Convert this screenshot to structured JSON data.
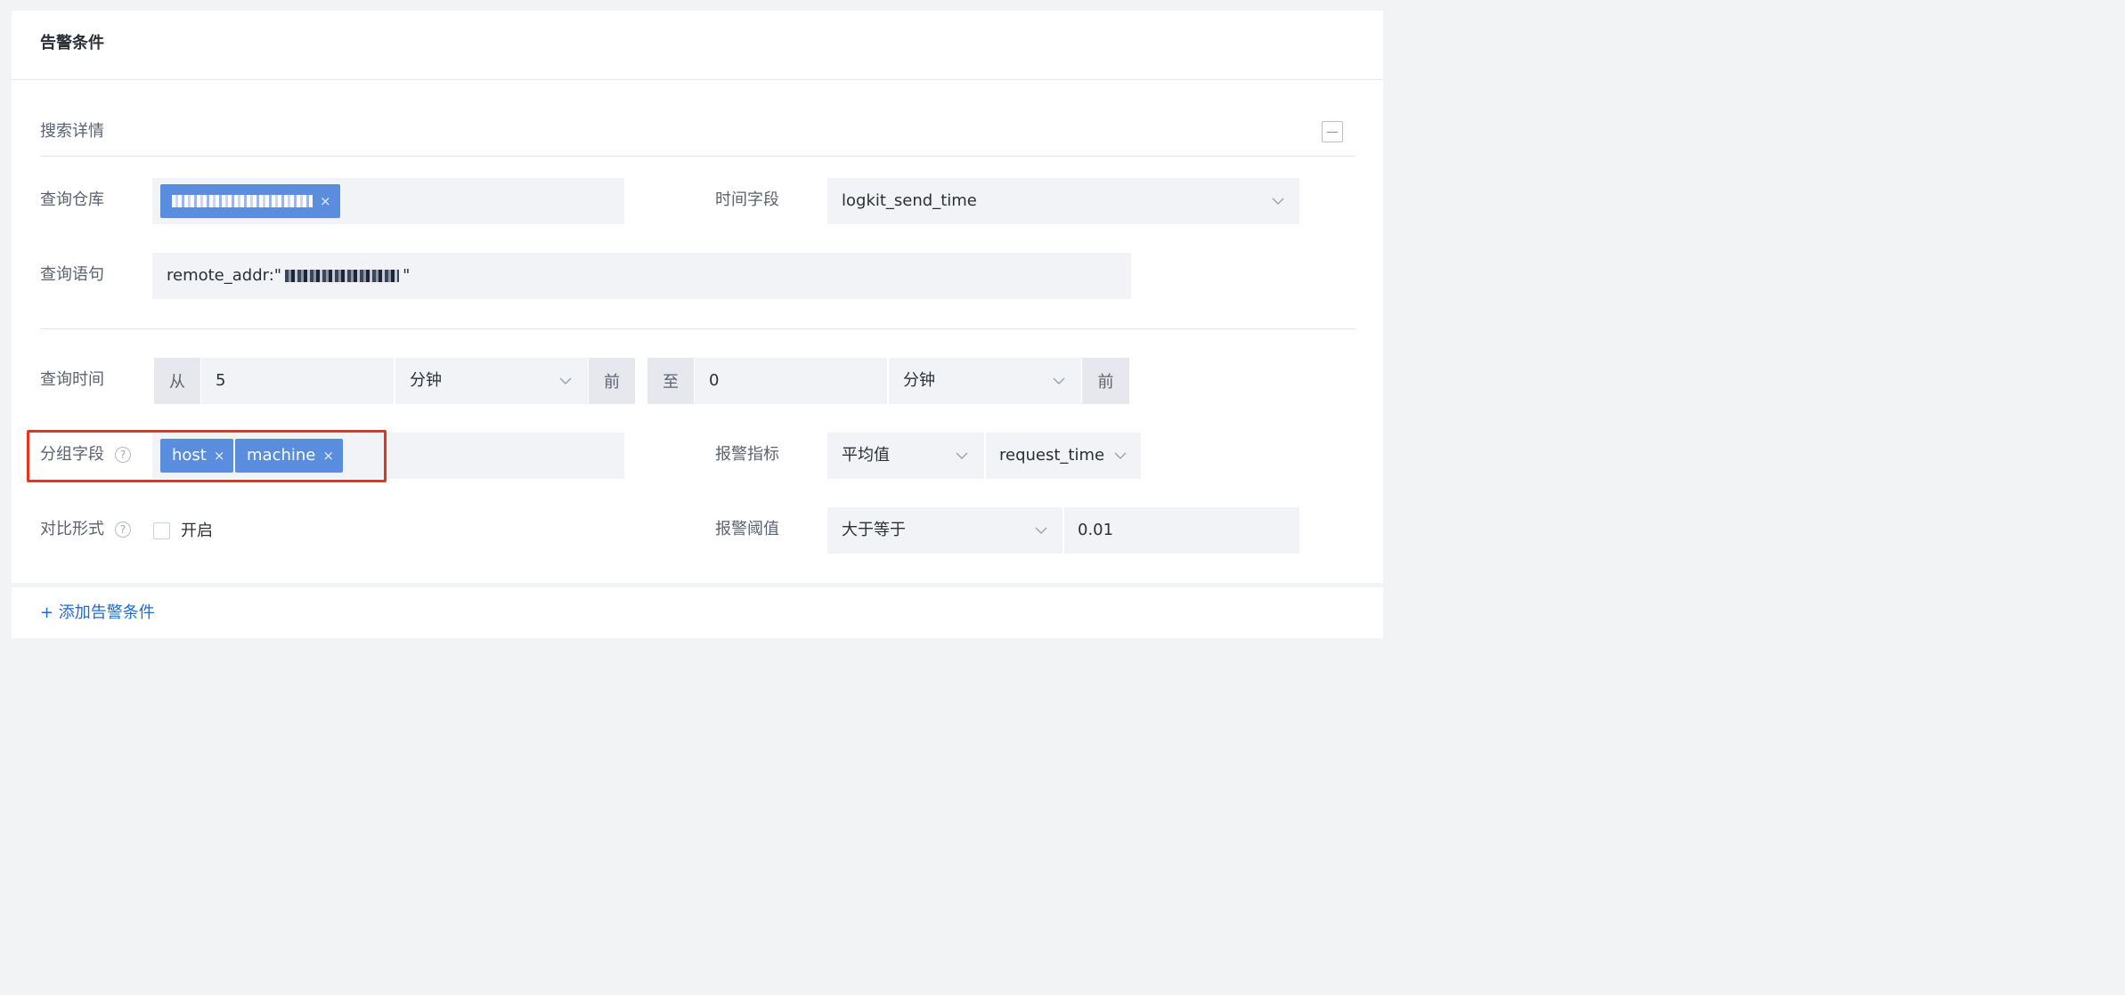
{
  "section": {
    "title": "告警条件"
  },
  "search_detail": {
    "title": "搜索详情"
  },
  "fields": {
    "repo": {
      "label": "查询仓库",
      "tag_close": "×"
    },
    "time_field": {
      "label": "时间字段",
      "value": "logkit_send_time"
    },
    "query": {
      "label": "查询语句",
      "prefix": "remote_addr:\"",
      "suffix": "\""
    },
    "query_time": {
      "label": "查询时间",
      "from_label": "从",
      "from_value": "5",
      "from_unit": "分钟",
      "from_suffix": "前",
      "to_label": "至",
      "to_value": "0",
      "to_unit": "分钟",
      "to_suffix": "前"
    },
    "group": {
      "label": "分组字段",
      "help": "?",
      "tags": [
        {
          "label": "host",
          "close": "×"
        },
        {
          "label": "machine",
          "close": "×"
        }
      ],
      "highlight_color": "#e8341c"
    },
    "metric": {
      "label": "报警指标",
      "agg": "平均值",
      "field": "request_time"
    },
    "compare": {
      "label": "对比形式",
      "help": "?",
      "checkbox_label": "开启",
      "checked": false
    },
    "threshold": {
      "label": "报警阈值",
      "operator": "大于等于",
      "value": "0.01"
    }
  },
  "footer": {
    "add_label": "+ 添加告警条件"
  },
  "colors": {
    "accent": "#1f6ad6",
    "tag": "#5b8ddf"
  }
}
